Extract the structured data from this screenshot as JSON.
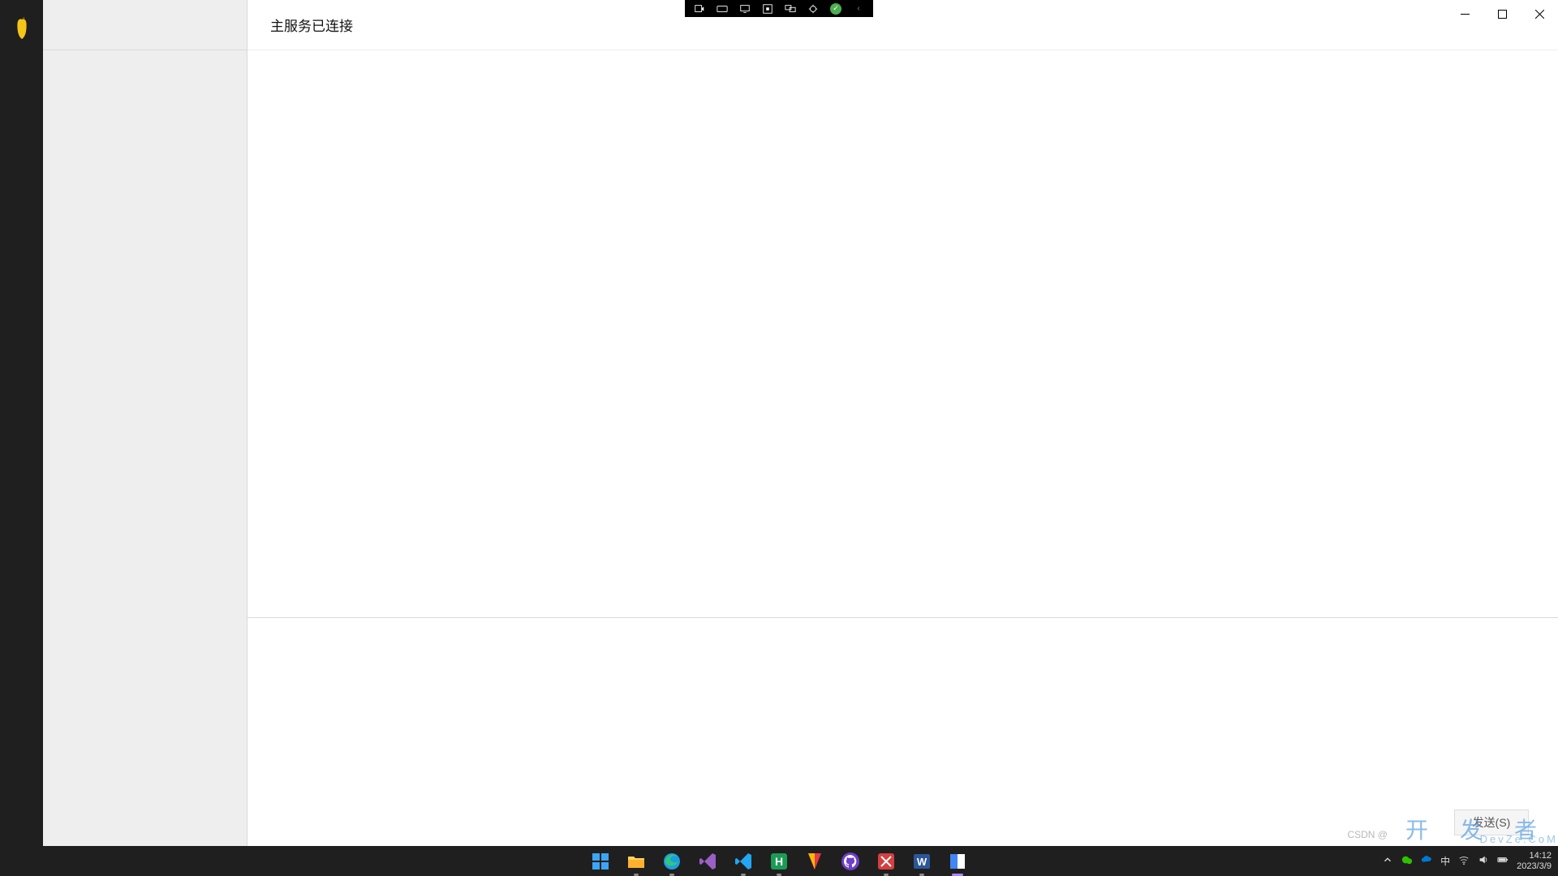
{
  "header": {
    "title": "主服务已连接"
  },
  "compose": {
    "send_label": "发送(S)"
  },
  "top_toolbar_icons": [
    "connect-icon",
    "video-icon",
    "desktop-icon",
    "stop-icon",
    "multi-monitor-icon",
    "debug-icon",
    "status-ok-icon",
    "collapse-icon"
  ],
  "window_controls": [
    "minimize",
    "maximize",
    "close"
  ],
  "taskbar": {
    "apps": [
      {
        "name": "start",
        "running": false
      },
      {
        "name": "file-explorer",
        "running": true
      },
      {
        "name": "edge",
        "running": true
      },
      {
        "name": "visual-studio",
        "running": false
      },
      {
        "name": "vscode",
        "running": true
      },
      {
        "name": "hbuilder",
        "running": true
      },
      {
        "name": "bandicam",
        "running": false
      },
      {
        "name": "github-desktop",
        "running": false
      },
      {
        "name": "xshell",
        "running": true
      },
      {
        "name": "word",
        "running": true
      },
      {
        "name": "current-app",
        "running": true,
        "active": true
      }
    ]
  },
  "system_tray": {
    "ime": "中",
    "time": "14:12",
    "date": "2023/3/9"
  },
  "watermark": {
    "main": "开 发 者",
    "sub": "DevZe.CoM",
    "csdn": "CSDN @"
  }
}
